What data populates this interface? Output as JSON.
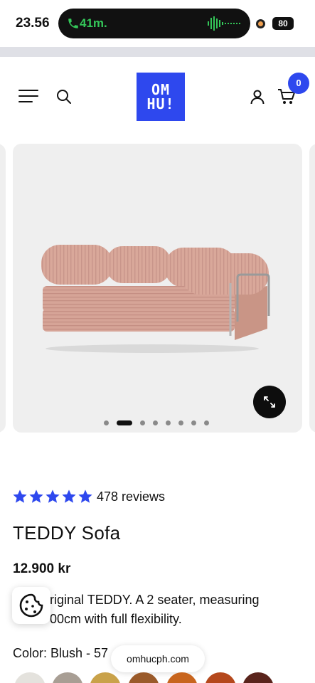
{
  "status_bar": {
    "time": "23.56",
    "call_duration": "41m.",
    "battery": "80"
  },
  "header": {
    "logo_line1": "OM",
    "logo_line2": "HU!",
    "cart_count": "0",
    "brand_color": "#2e48ee"
  },
  "gallery": {
    "slide_count": 8,
    "active_slide": 2,
    "image_alt": "pink corduroy sofa"
  },
  "product": {
    "rating": 5,
    "reviews": "478 reviews",
    "title": "TEDDY Sofa",
    "price": "12.900 kr",
    "description_line1": "riginal TEDDY. A 2 seater, measuring",
    "description_line2": "00cm with full flexibility.",
    "color_label": "Color: Blush - 57"
  },
  "overlay": {
    "url": "omhucph.com"
  },
  "swatches": [
    "#e4e2dd",
    "#a89e94",
    "#c9a24a",
    "#9a5a2a",
    "#c8651e",
    "#b5481c",
    "#5a241c"
  ]
}
